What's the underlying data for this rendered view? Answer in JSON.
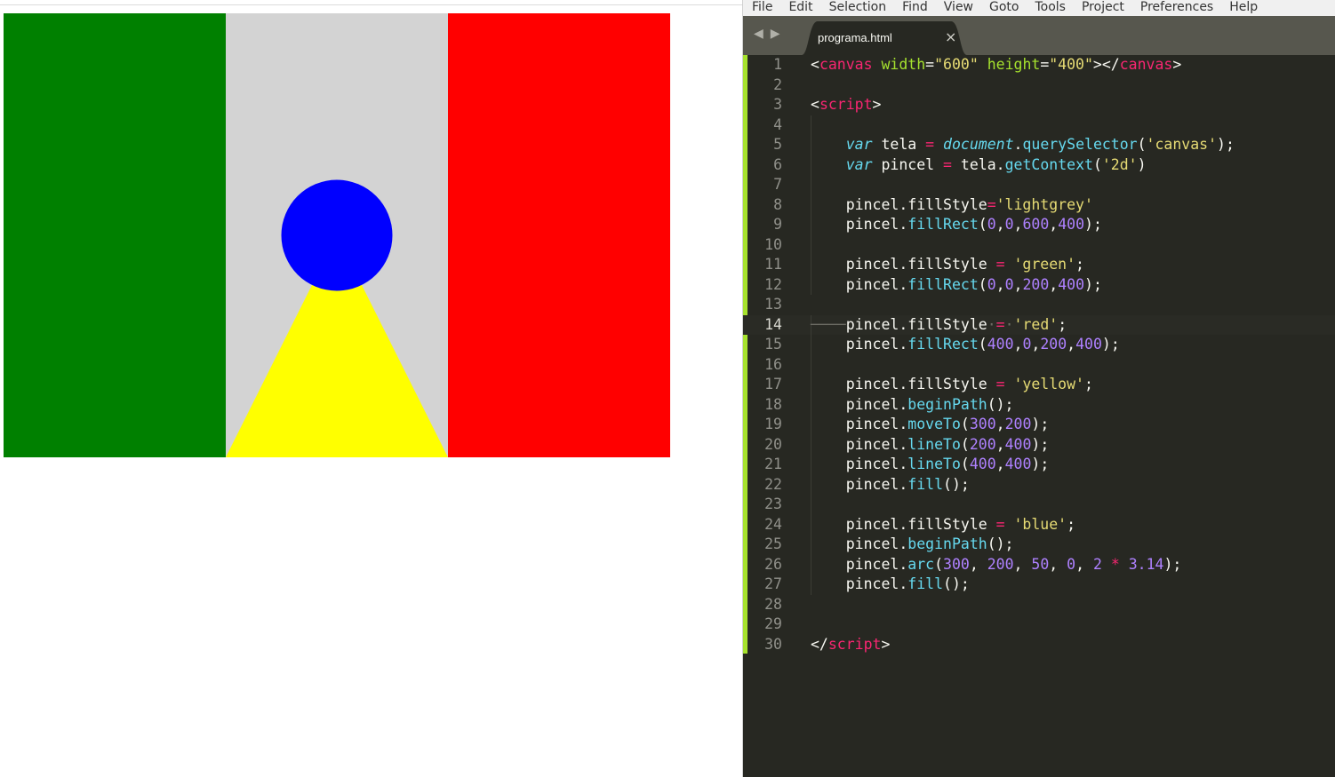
{
  "menu": [
    "File",
    "Edit",
    "Selection",
    "Find",
    "View",
    "Goto",
    "Tools",
    "Project",
    "Preferences",
    "Help"
  ],
  "tab": {
    "title": "programa.html",
    "close": "×"
  },
  "nav": {
    "back": "◀",
    "forward": "▶"
  },
  "colors": {
    "canvas_bg": "lightgrey",
    "left_band": "green",
    "right_band": "red",
    "triangle": "yellow",
    "circle": "blue",
    "editor_bg": "#272822",
    "gutter_marker": "#a6e22e"
  },
  "code_lines": [
    [
      [
        "p",
        "<"
      ],
      [
        "t",
        "canvas"
      ],
      [
        "p",
        " "
      ],
      [
        "a",
        "width"
      ],
      [
        "p",
        "="
      ],
      [
        "s",
        "\"600\""
      ],
      [
        "p",
        " "
      ],
      [
        "a",
        "height"
      ],
      [
        "p",
        "="
      ],
      [
        "s",
        "\"400\""
      ],
      [
        "p",
        "></"
      ],
      [
        "t",
        "canvas"
      ],
      [
        "p",
        ">"
      ]
    ],
    [],
    [
      [
        "p",
        "<"
      ],
      [
        "t",
        "script"
      ],
      [
        "p",
        ">"
      ]
    ],
    [],
    [
      [
        "p",
        "    "
      ],
      [
        "v",
        "var"
      ],
      [
        "p",
        " tela "
      ],
      [
        "t",
        "="
      ],
      [
        "p",
        " "
      ],
      [
        "v",
        "document"
      ],
      [
        "p",
        "."
      ],
      [
        "f",
        "querySelector"
      ],
      [
        "p",
        "("
      ],
      [
        "s",
        "'canvas'"
      ],
      [
        "p",
        ");"
      ]
    ],
    [
      [
        "p",
        "    "
      ],
      [
        "v",
        "var"
      ],
      [
        "p",
        " pincel "
      ],
      [
        "t",
        "="
      ],
      [
        "p",
        " tela."
      ],
      [
        "f",
        "getContext"
      ],
      [
        "p",
        "("
      ],
      [
        "s",
        "'2d'"
      ],
      [
        "p",
        ")"
      ]
    ],
    [],
    [
      [
        "p",
        "    pincel.fillStyle"
      ],
      [
        "t",
        "="
      ],
      [
        "s",
        "'lightgrey'"
      ]
    ],
    [
      [
        "p",
        "    pincel."
      ],
      [
        "f",
        "fillRect"
      ],
      [
        "p",
        "("
      ],
      [
        "n",
        "0"
      ],
      [
        "p",
        ","
      ],
      [
        "n",
        "0"
      ],
      [
        "p",
        ","
      ],
      [
        "n",
        "600"
      ],
      [
        "p",
        ","
      ],
      [
        "n",
        "400"
      ],
      [
        "p",
        ");"
      ]
    ],
    [],
    [
      [
        "p",
        "    pincel.fillStyle "
      ],
      [
        "t",
        "="
      ],
      [
        "p",
        " "
      ],
      [
        "s",
        "'green'"
      ],
      [
        "p",
        ";"
      ]
    ],
    [
      [
        "p",
        "    pincel."
      ],
      [
        "f",
        "fillRect"
      ],
      [
        "p",
        "("
      ],
      [
        "n",
        "0"
      ],
      [
        "p",
        ","
      ],
      [
        "n",
        "0"
      ],
      [
        "p",
        ","
      ],
      [
        "n",
        "200"
      ],
      [
        "p",
        ","
      ],
      [
        "n",
        "400"
      ],
      [
        "p",
        ");"
      ]
    ],
    [],
    [
      [
        "ws",
        "────"
      ],
      [
        "p",
        "pincel.fillStyle"
      ],
      [
        "ws",
        "·"
      ],
      [
        "t",
        "="
      ],
      [
        "ws",
        "·"
      ],
      [
        "s",
        "'red'"
      ],
      [
        "p",
        ";"
      ]
    ],
    [
      [
        "p",
        "    pincel."
      ],
      [
        "f",
        "fillRect"
      ],
      [
        "p",
        "("
      ],
      [
        "n",
        "400"
      ],
      [
        "p",
        ","
      ],
      [
        "n",
        "0"
      ],
      [
        "p",
        ","
      ],
      [
        "n",
        "200"
      ],
      [
        "p",
        ","
      ],
      [
        "n",
        "400"
      ],
      [
        "p",
        ");"
      ]
    ],
    [],
    [
      [
        "p",
        "    pincel.fillStyle "
      ],
      [
        "t",
        "="
      ],
      [
        "p",
        " "
      ],
      [
        "s",
        "'yellow'"
      ],
      [
        "p",
        ";"
      ]
    ],
    [
      [
        "p",
        "    pincel."
      ],
      [
        "f",
        "beginPath"
      ],
      [
        "p",
        "();"
      ]
    ],
    [
      [
        "p",
        "    pincel."
      ],
      [
        "f",
        "moveTo"
      ],
      [
        "p",
        "("
      ],
      [
        "n",
        "300"
      ],
      [
        "p",
        ","
      ],
      [
        "n",
        "200"
      ],
      [
        "p",
        ");"
      ]
    ],
    [
      [
        "p",
        "    pincel."
      ],
      [
        "f",
        "lineTo"
      ],
      [
        "p",
        "("
      ],
      [
        "n",
        "200"
      ],
      [
        "p",
        ","
      ],
      [
        "n",
        "400"
      ],
      [
        "p",
        ");"
      ]
    ],
    [
      [
        "p",
        "    pincel."
      ],
      [
        "f",
        "lineTo"
      ],
      [
        "p",
        "("
      ],
      [
        "n",
        "400"
      ],
      [
        "p",
        ","
      ],
      [
        "n",
        "400"
      ],
      [
        "p",
        ");"
      ]
    ],
    [
      [
        "p",
        "    pincel."
      ],
      [
        "f",
        "fill"
      ],
      [
        "p",
        "();"
      ]
    ],
    [],
    [
      [
        "p",
        "    pincel.fillStyle "
      ],
      [
        "t",
        "="
      ],
      [
        "p",
        " "
      ],
      [
        "s",
        "'blue'"
      ],
      [
        "p",
        ";"
      ]
    ],
    [
      [
        "p",
        "    pincel."
      ],
      [
        "f",
        "beginPath"
      ],
      [
        "p",
        "();"
      ]
    ],
    [
      [
        "p",
        "    pincel."
      ],
      [
        "f",
        "arc"
      ],
      [
        "p",
        "("
      ],
      [
        "n",
        "300"
      ],
      [
        "p",
        ", "
      ],
      [
        "n",
        "200"
      ],
      [
        "p",
        ", "
      ],
      [
        "n",
        "50"
      ],
      [
        "p",
        ", "
      ],
      [
        "n",
        "0"
      ],
      [
        "p",
        ", "
      ],
      [
        "n",
        "2"
      ],
      [
        "p",
        " "
      ],
      [
        "t",
        "*"
      ],
      [
        "p",
        " "
      ],
      [
        "n",
        "3.14"
      ],
      [
        "p",
        ");"
      ]
    ],
    [
      [
        "p",
        "    pincel."
      ],
      [
        "f",
        "fill"
      ],
      [
        "p",
        "();"
      ]
    ],
    [],
    [],
    [
      [
        "p",
        "</"
      ],
      [
        "t",
        "script"
      ],
      [
        "p",
        ">"
      ]
    ]
  ],
  "current_line": 14
}
